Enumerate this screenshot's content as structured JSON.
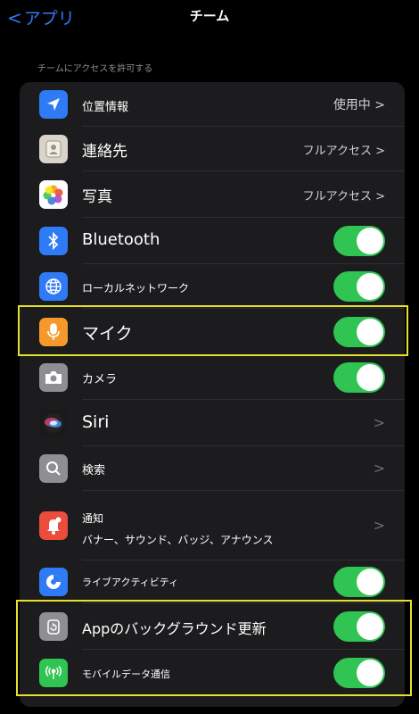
{
  "nav": {
    "back_label": "アプリ",
    "title": "チーム"
  },
  "section": {
    "label": "チームにアクセスを許可する"
  },
  "rows": [
    {
      "label": "位置情報",
      "value": "使用中 >",
      "icon": "location-arrow-icon",
      "icon_color": "#2f7bf5"
    },
    {
      "label": "連絡先",
      "value": "フルアクセス >",
      "icon": "contacts-icon",
      "icon_color": "#d9d3c9"
    },
    {
      "label": "写真",
      "value": "フルアクセス >",
      "icon": "photos-icon",
      "icon_color": "#ffffff"
    },
    {
      "label": "Bluetooth",
      "toggle": true,
      "icon": "bluetooth-icon",
      "icon_color": "#2f7bf5"
    },
    {
      "label": "ローカルネットワーク",
      "toggle": true,
      "icon": "globe-icon",
      "icon_color": "#2f7bf5"
    },
    {
      "label": "マイク",
      "toggle": true,
      "icon": "microphone-icon",
      "icon_color": "#f59a2a"
    },
    {
      "label": "カメラ",
      "toggle": true,
      "icon": "camera-icon",
      "icon_color": "#8e8e93"
    },
    {
      "label": "Siri",
      "chevron": ">",
      "icon": "siri-icon",
      "icon_color": "#1a1a1a"
    },
    {
      "label": "検索",
      "chevron": ">",
      "icon": "search-icon",
      "icon_color": "#8e8e93"
    },
    {
      "label": "通知",
      "sublabel": "バナー、サウンド、バッジ、アナウンス",
      "chevron": ">",
      "icon": "notification-bell-icon",
      "icon_color": "#eb4d3d"
    },
    {
      "label": "ライブアクティビティ",
      "toggle": true,
      "icon": "live-activity-icon",
      "icon_color": "#2f7bf5"
    },
    {
      "label": "Appのバックグラウンド更新",
      "toggle": true,
      "icon": "gear-refresh-icon",
      "icon_color": "#8e8e93"
    },
    {
      "label": "モバイルデータ通信",
      "toggle": true,
      "icon": "antenna-icon",
      "icon_color": "#30c452"
    }
  ],
  "highlight_color": "#e6e12a",
  "accent_color": "#2f7bf5",
  "toggle_on_color": "#30c452"
}
